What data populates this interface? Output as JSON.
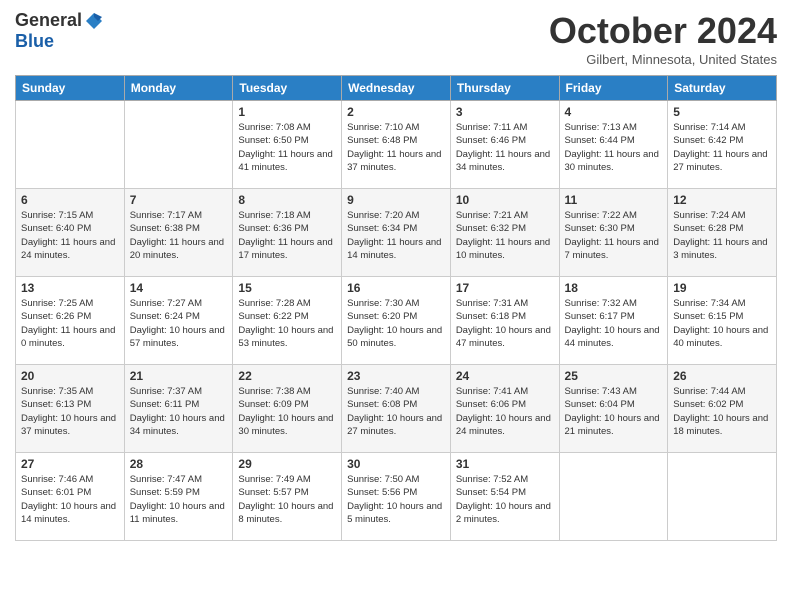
{
  "header": {
    "logo_general": "General",
    "logo_blue": "Blue",
    "month_title": "October 2024",
    "location": "Gilbert, Minnesota, United States"
  },
  "weekdays": [
    "Sunday",
    "Monday",
    "Tuesday",
    "Wednesday",
    "Thursday",
    "Friday",
    "Saturday"
  ],
  "weeks": [
    [
      {
        "day": "",
        "info": ""
      },
      {
        "day": "",
        "info": ""
      },
      {
        "day": "1",
        "info": "Sunrise: 7:08 AM\nSunset: 6:50 PM\nDaylight: 11 hours and 41 minutes."
      },
      {
        "day": "2",
        "info": "Sunrise: 7:10 AM\nSunset: 6:48 PM\nDaylight: 11 hours and 37 minutes."
      },
      {
        "day": "3",
        "info": "Sunrise: 7:11 AM\nSunset: 6:46 PM\nDaylight: 11 hours and 34 minutes."
      },
      {
        "day": "4",
        "info": "Sunrise: 7:13 AM\nSunset: 6:44 PM\nDaylight: 11 hours and 30 minutes."
      },
      {
        "day": "5",
        "info": "Sunrise: 7:14 AM\nSunset: 6:42 PM\nDaylight: 11 hours and 27 minutes."
      }
    ],
    [
      {
        "day": "6",
        "info": "Sunrise: 7:15 AM\nSunset: 6:40 PM\nDaylight: 11 hours and 24 minutes."
      },
      {
        "day": "7",
        "info": "Sunrise: 7:17 AM\nSunset: 6:38 PM\nDaylight: 11 hours and 20 minutes."
      },
      {
        "day": "8",
        "info": "Sunrise: 7:18 AM\nSunset: 6:36 PM\nDaylight: 11 hours and 17 minutes."
      },
      {
        "day": "9",
        "info": "Sunrise: 7:20 AM\nSunset: 6:34 PM\nDaylight: 11 hours and 14 minutes."
      },
      {
        "day": "10",
        "info": "Sunrise: 7:21 AM\nSunset: 6:32 PM\nDaylight: 11 hours and 10 minutes."
      },
      {
        "day": "11",
        "info": "Sunrise: 7:22 AM\nSunset: 6:30 PM\nDaylight: 11 hours and 7 minutes."
      },
      {
        "day": "12",
        "info": "Sunrise: 7:24 AM\nSunset: 6:28 PM\nDaylight: 11 hours and 3 minutes."
      }
    ],
    [
      {
        "day": "13",
        "info": "Sunrise: 7:25 AM\nSunset: 6:26 PM\nDaylight: 11 hours and 0 minutes."
      },
      {
        "day": "14",
        "info": "Sunrise: 7:27 AM\nSunset: 6:24 PM\nDaylight: 10 hours and 57 minutes."
      },
      {
        "day": "15",
        "info": "Sunrise: 7:28 AM\nSunset: 6:22 PM\nDaylight: 10 hours and 53 minutes."
      },
      {
        "day": "16",
        "info": "Sunrise: 7:30 AM\nSunset: 6:20 PM\nDaylight: 10 hours and 50 minutes."
      },
      {
        "day": "17",
        "info": "Sunrise: 7:31 AM\nSunset: 6:18 PM\nDaylight: 10 hours and 47 minutes."
      },
      {
        "day": "18",
        "info": "Sunrise: 7:32 AM\nSunset: 6:17 PM\nDaylight: 10 hours and 44 minutes."
      },
      {
        "day": "19",
        "info": "Sunrise: 7:34 AM\nSunset: 6:15 PM\nDaylight: 10 hours and 40 minutes."
      }
    ],
    [
      {
        "day": "20",
        "info": "Sunrise: 7:35 AM\nSunset: 6:13 PM\nDaylight: 10 hours and 37 minutes."
      },
      {
        "day": "21",
        "info": "Sunrise: 7:37 AM\nSunset: 6:11 PM\nDaylight: 10 hours and 34 minutes."
      },
      {
        "day": "22",
        "info": "Sunrise: 7:38 AM\nSunset: 6:09 PM\nDaylight: 10 hours and 30 minutes."
      },
      {
        "day": "23",
        "info": "Sunrise: 7:40 AM\nSunset: 6:08 PM\nDaylight: 10 hours and 27 minutes."
      },
      {
        "day": "24",
        "info": "Sunrise: 7:41 AM\nSunset: 6:06 PM\nDaylight: 10 hours and 24 minutes."
      },
      {
        "day": "25",
        "info": "Sunrise: 7:43 AM\nSunset: 6:04 PM\nDaylight: 10 hours and 21 minutes."
      },
      {
        "day": "26",
        "info": "Sunrise: 7:44 AM\nSunset: 6:02 PM\nDaylight: 10 hours and 18 minutes."
      }
    ],
    [
      {
        "day": "27",
        "info": "Sunrise: 7:46 AM\nSunset: 6:01 PM\nDaylight: 10 hours and 14 minutes."
      },
      {
        "day": "28",
        "info": "Sunrise: 7:47 AM\nSunset: 5:59 PM\nDaylight: 10 hours and 11 minutes."
      },
      {
        "day": "29",
        "info": "Sunrise: 7:49 AM\nSunset: 5:57 PM\nDaylight: 10 hours and 8 minutes."
      },
      {
        "day": "30",
        "info": "Sunrise: 7:50 AM\nSunset: 5:56 PM\nDaylight: 10 hours and 5 minutes."
      },
      {
        "day": "31",
        "info": "Sunrise: 7:52 AM\nSunset: 5:54 PM\nDaylight: 10 hours and 2 minutes."
      },
      {
        "day": "",
        "info": ""
      },
      {
        "day": "",
        "info": ""
      }
    ]
  ]
}
